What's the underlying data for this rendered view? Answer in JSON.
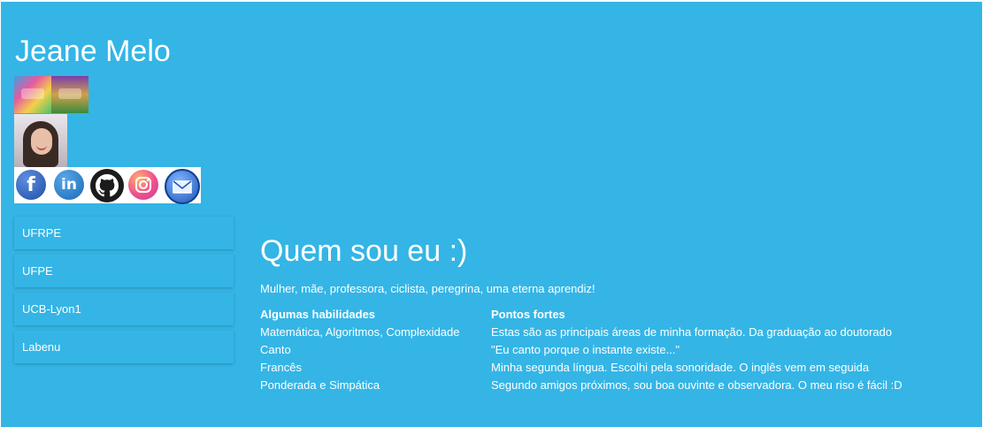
{
  "site": {
    "title": "Jeane Melo"
  },
  "social": {
    "icons": [
      "facebook-icon",
      "linkedin-icon",
      "github-icon",
      "instagram-icon",
      "email-icon"
    ]
  },
  "nav": {
    "items": [
      {
        "label": "UFRPE"
      },
      {
        "label": "UFPE"
      },
      {
        "label": "UCB-Lyon1"
      },
      {
        "label": "Labenu"
      }
    ]
  },
  "main": {
    "title": "Quem sou eu :)",
    "intro": "Mulher, mãe, professora, ciclista, peregrina, uma eterna aprendiz!",
    "table": {
      "headers": [
        "Algumas habilidades",
        "Pontos fortes"
      ],
      "rows": [
        [
          "Matemática, Algoritmos, Complexidade",
          "Estas são as principais áreas de minha formação. Da graduação ao doutorado"
        ],
        [
          "Canto",
          "\"Eu canto porque o instante existe...\""
        ],
        [
          "Francês",
          "Minha segunda língua. Escolhi pela sonoridade. O inglês vem em seguida"
        ],
        [
          "Ponderada e Simpática",
          "Segundo amigos próximos, sou boa ouvinte e observadora. O meu riso é fácil :D"
        ]
      ]
    }
  },
  "colors": {
    "background": "#34b5e6",
    "text": "#ffffff"
  }
}
